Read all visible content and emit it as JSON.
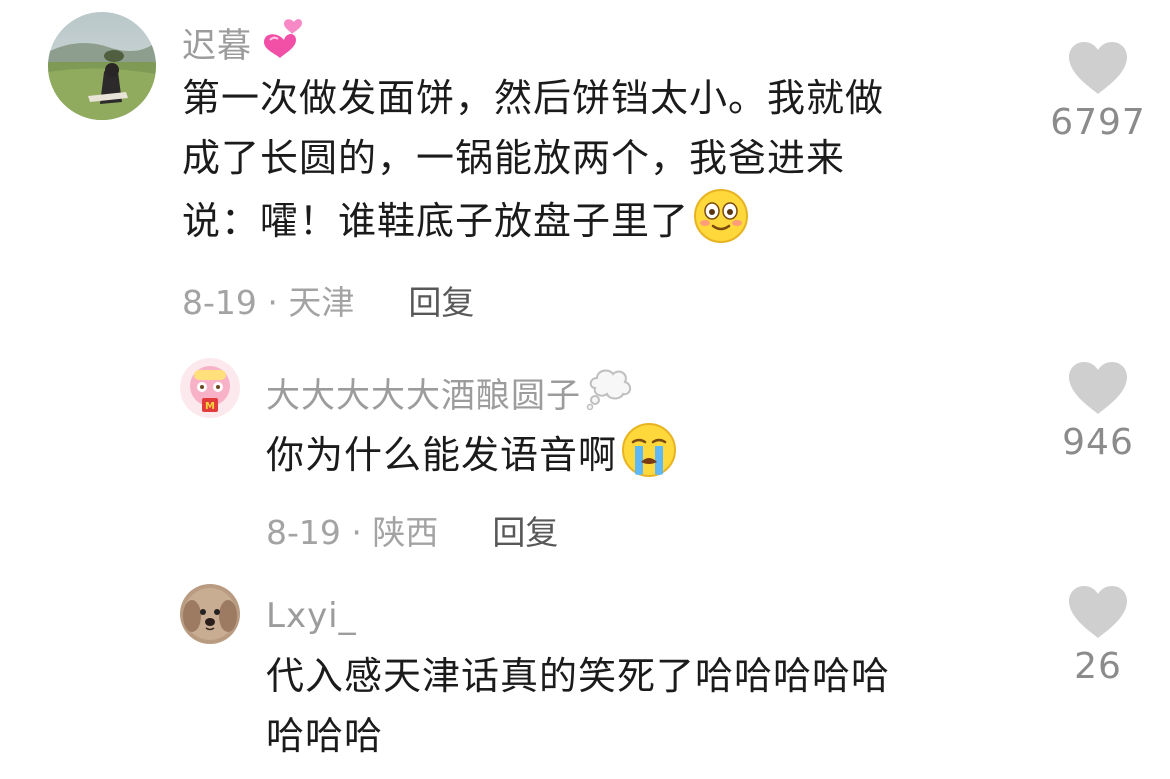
{
  "comments": [
    {
      "username": "迟暮",
      "text_lines": [
        "第一次做发面饼，然后饼铛太小。我就做",
        "成了长圆的，一锅能放两个，我爸进来",
        "说：嚯！谁鞋底子放盘子里了"
      ],
      "date_location": "8-19 · 天津",
      "reply_label": "回复",
      "likes": "6797",
      "badge_icon": "two-hearts-icon",
      "emoji_icon": "smiling-face-icon"
    },
    {
      "username": "大大大大大酒酿圆子",
      "text_lines": [
        "你为什么能发语音啊"
      ],
      "date_location": "8-19 · 陕西",
      "reply_label": "回复",
      "likes": "946",
      "badge_icon": "thought-bubble-icon",
      "emoji_icon": "crying-face-icon"
    },
    {
      "username": "Lxyi_",
      "text_lines": [
        "代入感天津话真的笑死了哈哈哈哈哈",
        "哈哈哈"
      ],
      "likes": "26"
    }
  ],
  "colors": {
    "username": "#9c9c9c",
    "text": "#1b1b1b",
    "meta": "#a3a3a3",
    "reply": "#585858",
    "heart": "#cfcfcf",
    "like_count": "#8b8b8b"
  }
}
